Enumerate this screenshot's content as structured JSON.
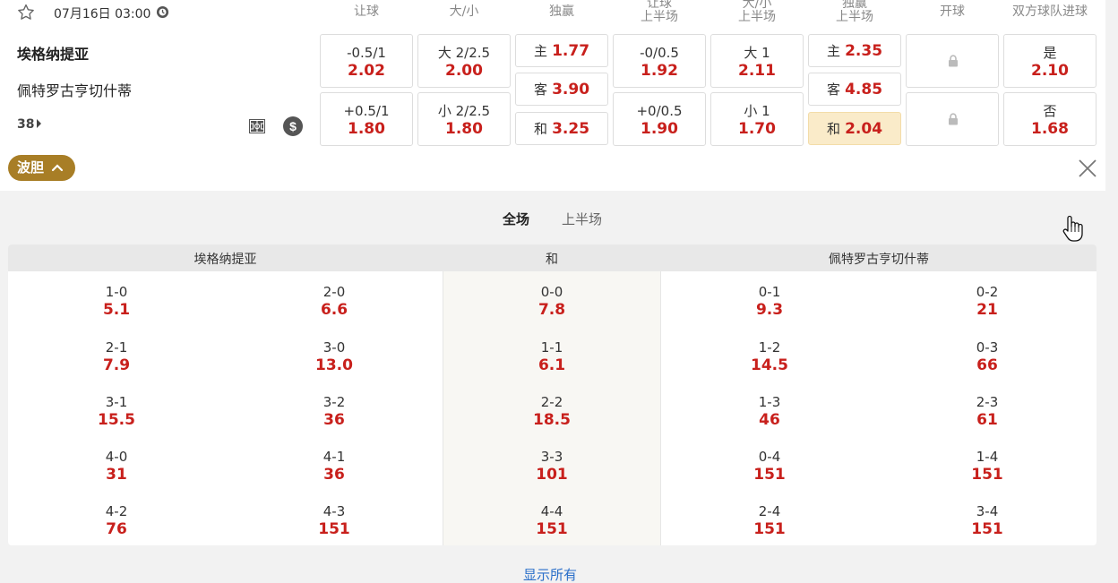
{
  "header": {
    "datetime": "07月16日 03:00",
    "columns": [
      "让球",
      "大/小",
      "独赢",
      "让球\n上半场",
      "大/小\n上半场",
      "独赢\n上半场",
      "开球",
      "双方球队进球"
    ]
  },
  "match": {
    "home": "埃格纳提亚",
    "away": "佩特罗古亨切什蒂",
    "more_count": "38"
  },
  "odds": {
    "handicap": [
      {
        "label": "-0.5/1",
        "odd": "2.02"
      },
      {
        "label": "+0.5/1",
        "odd": "1.80"
      }
    ],
    "overunder": [
      {
        "label": "大 2/2.5",
        "odd": "2.00"
      },
      {
        "label": "小 2/2.5",
        "odd": "1.80"
      }
    ],
    "moneyline": [
      {
        "label": "主",
        "odd": "1.77"
      },
      {
        "label": "客",
        "odd": "3.90"
      },
      {
        "label": "和",
        "odd": "3.25"
      }
    ],
    "handicap_half": [
      {
        "label": "-0/0.5",
        "odd": "1.92"
      },
      {
        "label": "+0/0.5",
        "odd": "1.90"
      }
    ],
    "overunder_half": [
      {
        "label": "大 1",
        "odd": "2.11"
      },
      {
        "label": "小 1",
        "odd": "1.70"
      }
    ],
    "moneyline_half": [
      {
        "label": "主",
        "odd": "2.35"
      },
      {
        "label": "客",
        "odd": "4.85"
      },
      {
        "label": "和",
        "odd": "2.04"
      }
    ],
    "both_score": [
      {
        "label": "是",
        "odd": "2.10"
      },
      {
        "label": "否",
        "odd": "1.68"
      }
    ]
  },
  "bodan_label": "波胆",
  "tabs": [
    "全场",
    "上半场"
  ],
  "correct_score": {
    "headers": {
      "home": "埃格纳提亚",
      "draw": "和",
      "away": "佩特罗古亨切什蒂"
    },
    "home_col1": [
      {
        "s": "1-0",
        "o": "5.1"
      },
      {
        "s": "2-1",
        "o": "7.9"
      },
      {
        "s": "3-1",
        "o": "15.5"
      },
      {
        "s": "4-0",
        "o": "31"
      },
      {
        "s": "4-2",
        "o": "76"
      }
    ],
    "home_col2": [
      {
        "s": "2-0",
        "o": "6.6"
      },
      {
        "s": "3-0",
        "o": "13.0"
      },
      {
        "s": "3-2",
        "o": "36"
      },
      {
        "s": "4-1",
        "o": "36"
      },
      {
        "s": "4-3",
        "o": "151"
      }
    ],
    "draw": [
      {
        "s": "0-0",
        "o": "7.8"
      },
      {
        "s": "1-1",
        "o": "6.1"
      },
      {
        "s": "2-2",
        "o": "18.5"
      },
      {
        "s": "3-3",
        "o": "101"
      },
      {
        "s": "4-4",
        "o": "151"
      }
    ],
    "away_col1": [
      {
        "s": "0-1",
        "o": "9.3"
      },
      {
        "s": "1-2",
        "o": "14.5"
      },
      {
        "s": "1-3",
        "o": "46"
      },
      {
        "s": "0-4",
        "o": "151"
      },
      {
        "s": "2-4",
        "o": "151"
      }
    ],
    "away_col2": [
      {
        "s": "0-2",
        "o": "21"
      },
      {
        "s": "0-3",
        "o": "66"
      },
      {
        "s": "2-3",
        "o": "61"
      },
      {
        "s": "1-4",
        "o": "151"
      },
      {
        "s": "3-4",
        "o": "151"
      }
    ]
  },
  "show_all_label": "显示所有",
  "colors": {
    "odd_red": "#c8201c",
    "bodan_gold": "#a87e26",
    "highlight": "#faebc9",
    "link_blue": "#2a6fc9"
  }
}
